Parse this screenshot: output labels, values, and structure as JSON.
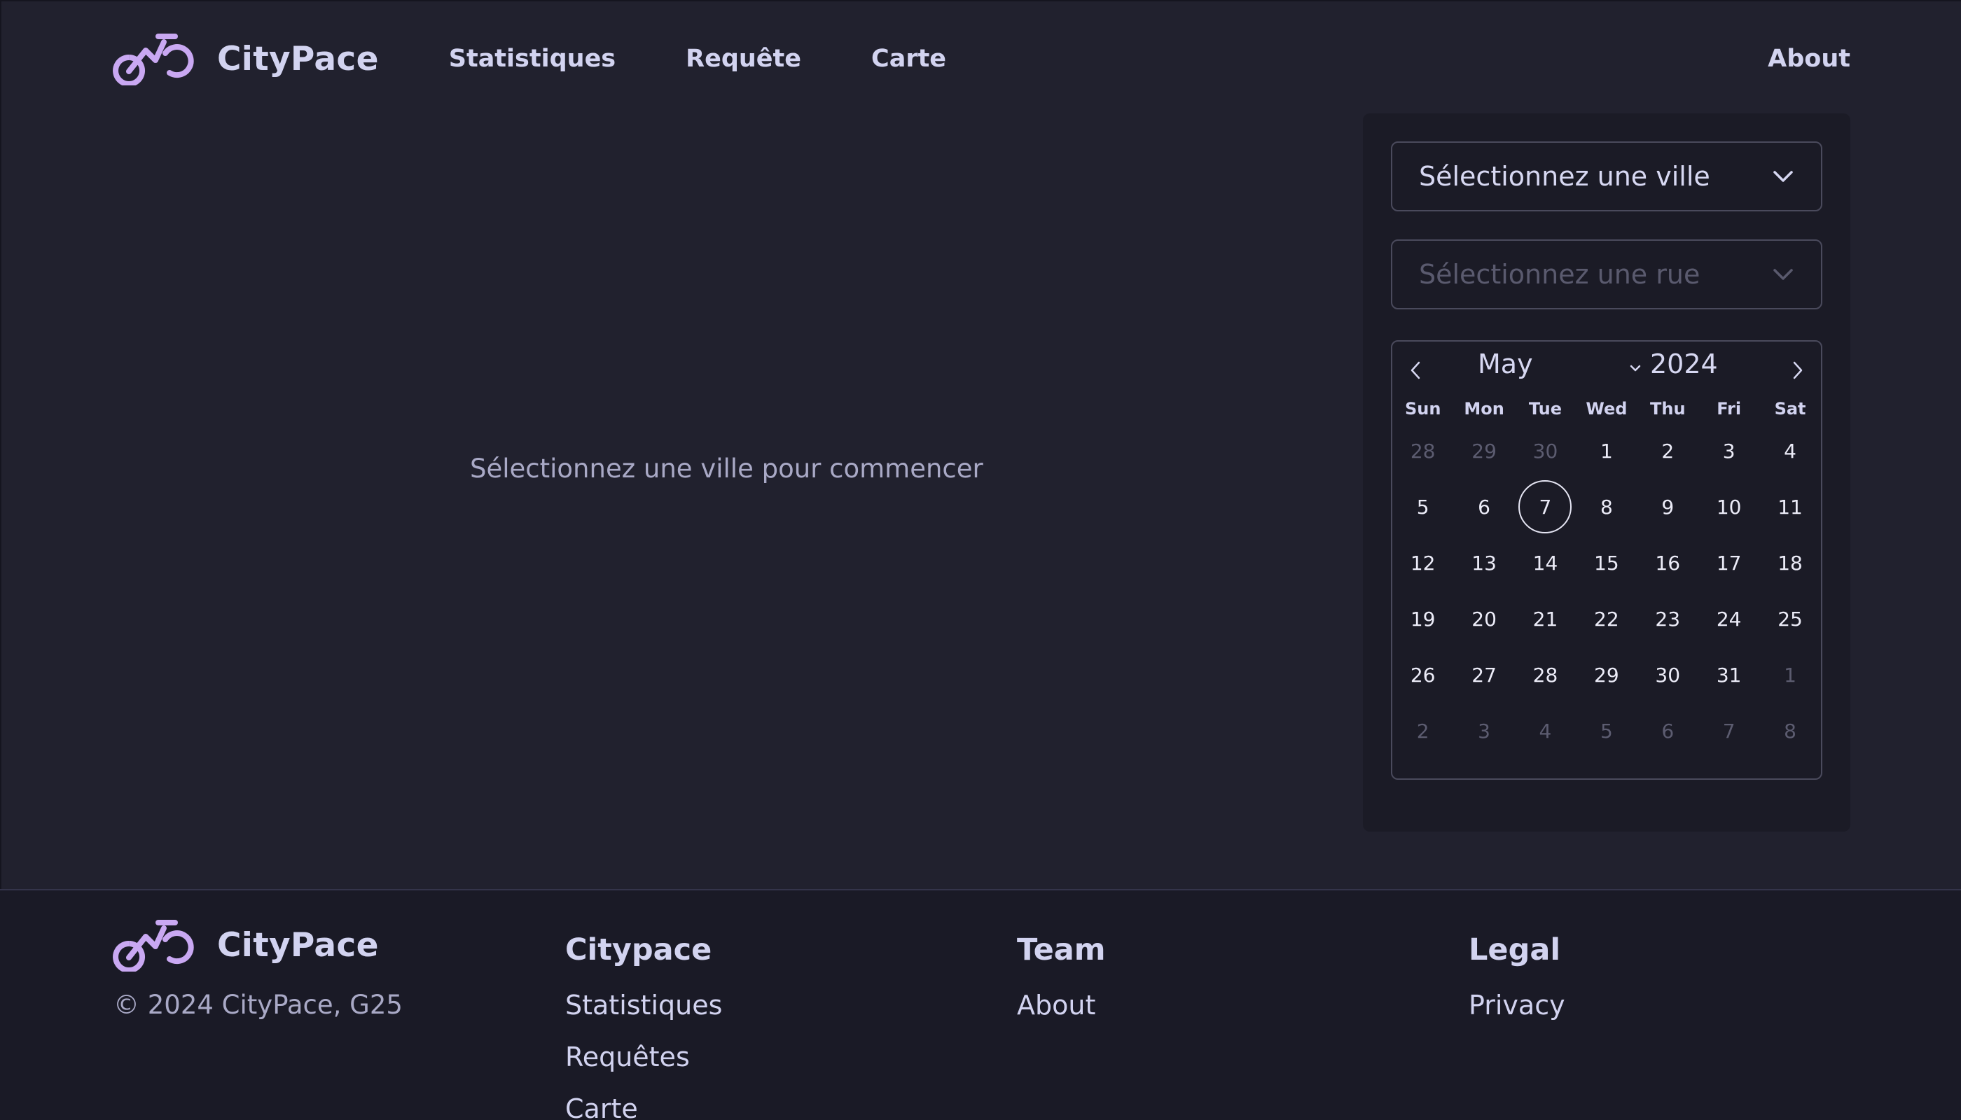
{
  "brand": {
    "name": "CityPace",
    "accent": "#c9a8f2"
  },
  "nav": {
    "items": [
      "Statistiques",
      "Requête",
      "Carte"
    ],
    "about": "About"
  },
  "main": {
    "placeholder": "Sélectionnez une ville pour commencer"
  },
  "filters": {
    "city_select": "Sélectionnez une ville",
    "street_select": "Sélectionnez une rue"
  },
  "calendar": {
    "month": "May",
    "year": "2024",
    "weekdays": [
      "Sun",
      "Mon",
      "Tue",
      "Wed",
      "Thu",
      "Fri",
      "Sat"
    ],
    "selected_day": "7",
    "weeks": [
      [
        {
          "d": "28",
          "muted": true
        },
        {
          "d": "29",
          "muted": true
        },
        {
          "d": "30",
          "muted": true
        },
        {
          "d": "1"
        },
        {
          "d": "2"
        },
        {
          "d": "3"
        },
        {
          "d": "4"
        }
      ],
      [
        {
          "d": "5"
        },
        {
          "d": "6"
        },
        {
          "d": "7",
          "selected": true
        },
        {
          "d": "8"
        },
        {
          "d": "9"
        },
        {
          "d": "10"
        },
        {
          "d": "11"
        }
      ],
      [
        {
          "d": "12"
        },
        {
          "d": "13"
        },
        {
          "d": "14"
        },
        {
          "d": "15"
        },
        {
          "d": "16"
        },
        {
          "d": "17"
        },
        {
          "d": "18"
        }
      ],
      [
        {
          "d": "19"
        },
        {
          "d": "20"
        },
        {
          "d": "21"
        },
        {
          "d": "22"
        },
        {
          "d": "23"
        },
        {
          "d": "24"
        },
        {
          "d": "25"
        }
      ],
      [
        {
          "d": "26"
        },
        {
          "d": "27"
        },
        {
          "d": "28"
        },
        {
          "d": "29"
        },
        {
          "d": "30"
        },
        {
          "d": "31"
        },
        {
          "d": "1",
          "muted": true
        }
      ],
      [
        {
          "d": "2",
          "muted": true
        },
        {
          "d": "3",
          "muted": true
        },
        {
          "d": "4",
          "muted": true
        },
        {
          "d": "5",
          "muted": true
        },
        {
          "d": "6",
          "muted": true
        },
        {
          "d": "7",
          "muted": true
        },
        {
          "d": "8",
          "muted": true
        }
      ]
    ]
  },
  "footer": {
    "brand": "CityPace",
    "copyright": "© 2024 CityPace, G25",
    "columns": [
      {
        "title": "Citypace",
        "links": [
          "Statistiques",
          "Requêtes",
          "Carte"
        ]
      },
      {
        "title": "Team",
        "links": [
          "About"
        ]
      },
      {
        "title": "Legal",
        "links": [
          "Privacy"
        ]
      }
    ]
  }
}
